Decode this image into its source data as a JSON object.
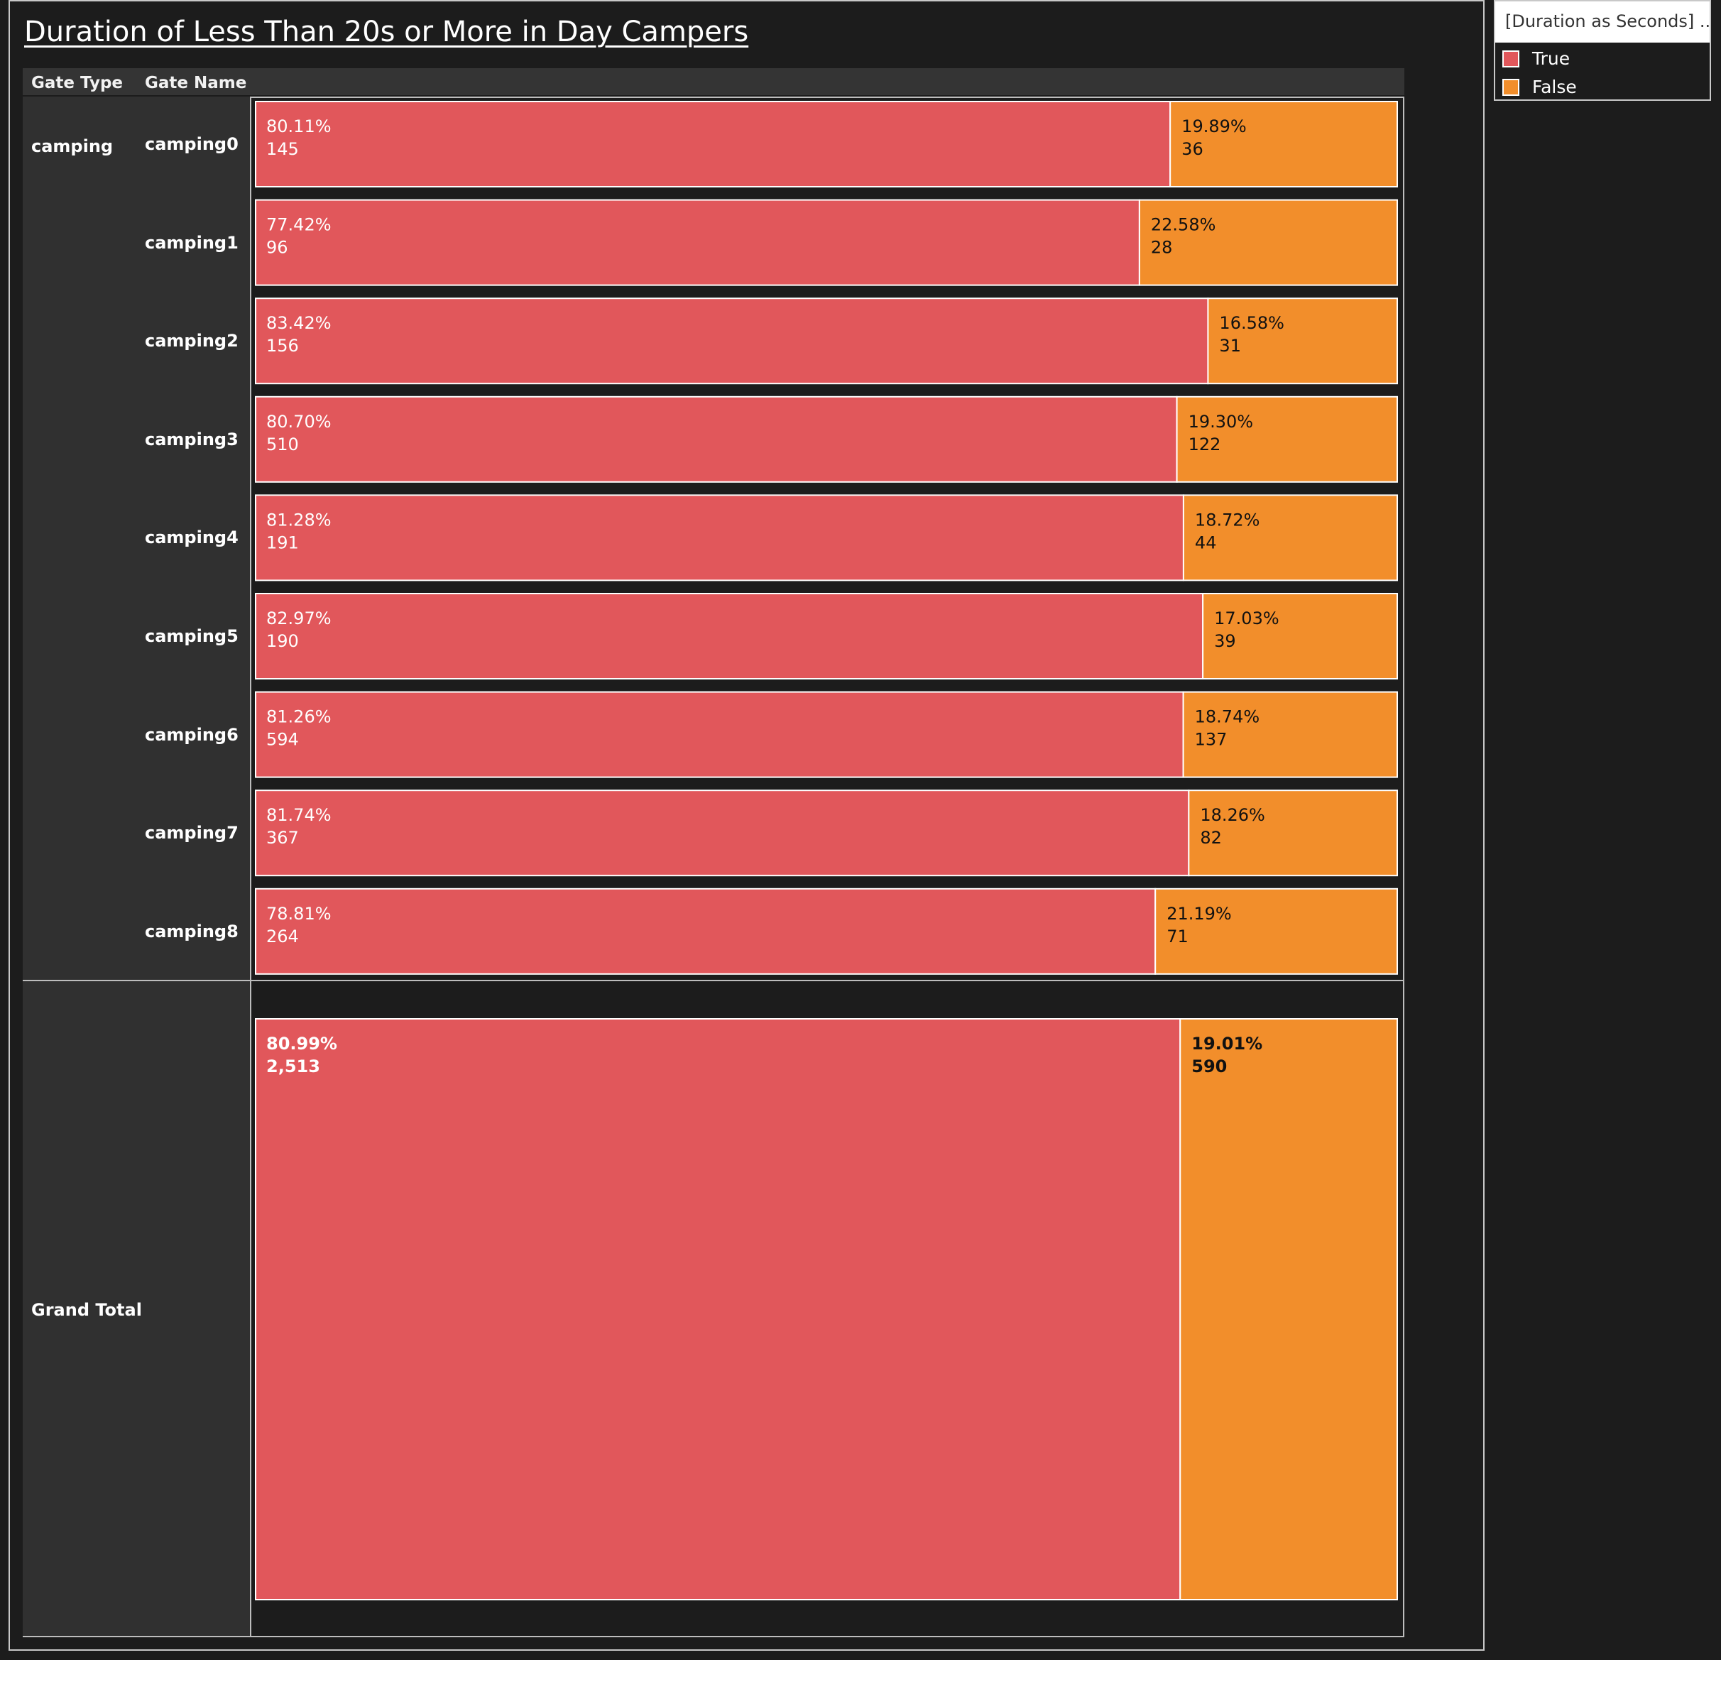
{
  "title": "Duration of Less Than 20s or More in Day Campers",
  "headers": {
    "gate_type": "Gate Type",
    "gate_name": "Gate Name"
  },
  "legend": {
    "title": "[Duration as Seconds] ...",
    "items": [
      {
        "label": "True",
        "color": "#e1575b"
      },
      {
        "label": "False",
        "color": "#f28e2b"
      }
    ]
  },
  "chart_data": {
    "type": "bar",
    "stacked": "percent",
    "orientation": "horizontal",
    "row_dimensions": [
      "Gate Type",
      "Gate Name"
    ],
    "gate_type": "camping",
    "categories": [
      "camping0",
      "camping1",
      "camping2",
      "camping3",
      "camping4",
      "camping5",
      "camping6",
      "camping7",
      "camping8"
    ],
    "series": [
      {
        "name": "True",
        "color": "#e1575b",
        "percent_labels": [
          "80.11%",
          "77.42%",
          "83.42%",
          "80.70%",
          "81.28%",
          "82.97%",
          "81.26%",
          "81.74%",
          "78.81%"
        ],
        "count_labels": [
          "145",
          "96",
          "156",
          "510",
          "191",
          "190",
          "594",
          "367",
          "264"
        ],
        "values": [
          145,
          96,
          156,
          510,
          191,
          190,
          594,
          367,
          264
        ]
      },
      {
        "name": "False",
        "color": "#f28e2b",
        "percent_labels": [
          "19.89%",
          "22.58%",
          "16.58%",
          "19.30%",
          "18.72%",
          "17.03%",
          "18.74%",
          "18.26%",
          "21.19%"
        ],
        "count_labels": [
          "36",
          "28",
          "31",
          "122",
          "44",
          "39",
          "137",
          "82",
          "71"
        ],
        "values": [
          36,
          28,
          31,
          122,
          44,
          39,
          137,
          82,
          71
        ]
      }
    ],
    "grand_total": {
      "label": "Grand Total",
      "true_percent": "80.99%",
      "true_count": "2,513",
      "true_value": 2513,
      "false_percent": "19.01%",
      "false_count": "590",
      "false_value": 590
    }
  }
}
